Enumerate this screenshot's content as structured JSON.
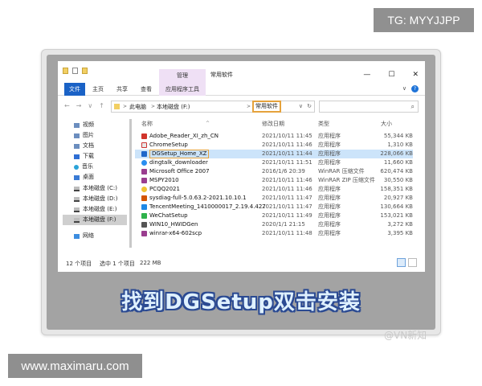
{
  "overlay": {
    "tg_badge": "TG: MYYJJPP",
    "url_badge": "www.maximaru.com",
    "watermark": "@VN新知"
  },
  "caption": "找到DGSetup双击安装",
  "window": {
    "context_tab_label": "管理",
    "title": "常用软件",
    "controls": {
      "minimize": "—",
      "maximize": "☐",
      "close": "✕"
    },
    "ribbon_tabs": [
      "文件",
      "主页",
      "共享",
      "查看",
      "应用程序工具"
    ],
    "ribbon_right": {
      "expand": "∨",
      "help": "?"
    }
  },
  "address": {
    "nav": {
      "back": "←",
      "forward": "→",
      "dropdown": "∨",
      "up": "↑"
    },
    "crumbs": [
      "此电脑",
      "本地磁盘 (F:)",
      "常用软件"
    ],
    "separator": ">",
    "refresh": "↻",
    "drop": "∨",
    "search_icon": "⌕"
  },
  "sidebar": {
    "items": [
      {
        "label": "视频",
        "icon": "video-icon"
      },
      {
        "label": "图片",
        "icon": "pictures-icon"
      },
      {
        "label": "文档",
        "icon": "documents-icon"
      },
      {
        "label": "下载",
        "icon": "downloads-icon"
      },
      {
        "label": "音乐",
        "icon": "music-icon"
      },
      {
        "label": "桌面",
        "icon": "desktop-icon"
      },
      {
        "label": "本地磁盘 (C:)",
        "icon": "drive-icon"
      },
      {
        "label": "本地磁盘 (D:)",
        "icon": "drive-icon"
      },
      {
        "label": "本地磁盘 (E:)",
        "icon": "drive-icon"
      },
      {
        "label": "本地磁盘 (F:)",
        "icon": "drive-icon",
        "selected": true
      },
      {
        "label": "网络",
        "icon": "network-icon"
      }
    ]
  },
  "columns": {
    "name": "名称",
    "date": "修改日期",
    "type": "类型",
    "size": "大小",
    "sort_arrow": "^"
  },
  "files": [
    {
      "name": "Adobe_Reader_XI_zh_CN",
      "date": "2021/10/11 11:45",
      "type": "应用程序",
      "size": "55,344 KB",
      "color": "#d1342b"
    },
    {
      "name": "ChromeSetup",
      "date": "2021/10/11 11:46",
      "type": "应用程序",
      "size": "1,310 KB",
      "color": "#e8e8e8"
    },
    {
      "name": "DGSetup_Home_XZ",
      "date": "2021/10/11 11:44",
      "type": "应用程序",
      "size": "228,066 KB",
      "color": "#1f67c9",
      "selected": true
    },
    {
      "name": "dingtalk_downloader",
      "date": "2021/10/11 11:51",
      "type": "应用程序",
      "size": "11,660 KB",
      "color": "#2a8ef0"
    },
    {
      "name": "Microsoft Office 2007",
      "date": "2016/1/6 20:39",
      "type": "WinRAR 压缩文件",
      "size": "620,474 KB",
      "color": "#9a3d8f"
    },
    {
      "name": "MSPY2010",
      "date": "2021/10/11 11:46",
      "type": "WinRAR ZIP 压缩文件",
      "size": "30,550 KB",
      "color": "#9a3d8f"
    },
    {
      "name": "PCQQ2021",
      "date": "2021/10/11 11:46",
      "type": "应用程序",
      "size": "158,351 KB",
      "color": "#f1c232"
    },
    {
      "name": "sysdiag-full-5.0.63.2-2021.10.10.1",
      "date": "2021/10/11 11:47",
      "type": "应用程序",
      "size": "20,927 KB",
      "color": "#d35400"
    },
    {
      "name": "TencentMeeting_1410000017_2.19.4.427",
      "date": "2021/10/11 11:47",
      "type": "应用程序",
      "size": "130,664 KB",
      "color": "#1e88e5"
    },
    {
      "name": "WeChatSetup",
      "date": "2021/10/11 11:49",
      "type": "应用程序",
      "size": "153,021 KB",
      "color": "#2fb24c"
    },
    {
      "name": "WIN10_HWIDGen",
      "date": "2020/1/1 21:15",
      "type": "应用程序",
      "size": "3,272 KB",
      "color": "#555555"
    },
    {
      "name": "winrar-x64-602scp",
      "date": "2021/10/11 11:48",
      "type": "应用程序",
      "size": "3,395 KB",
      "color": "#9a3d8f"
    }
  ],
  "status": {
    "count": "12 个项目",
    "selected": "选中 1 个项目",
    "size": "222 MB"
  },
  "colors": {
    "accent": "#1a62c6",
    "highlight": "#e5a23c",
    "selection": "#cce4fa",
    "context_tab": "#efe0f5"
  }
}
